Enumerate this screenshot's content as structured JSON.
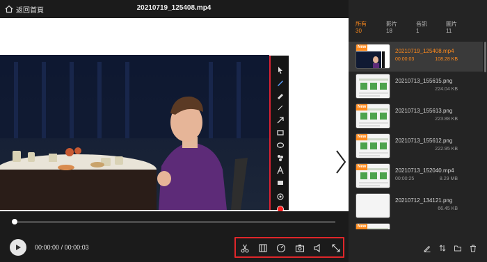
{
  "titlebar": {
    "back_label": "返回首頁",
    "title": "20210719_125408.mp4"
  },
  "player": {
    "current_time": "00:00:00",
    "separator": "/",
    "total_time": "00:00:03",
    "progress": 0.0
  },
  "toolbar_icons": [
    "scissors-icon",
    "trim-icon",
    "speed-icon",
    "snapshot-icon",
    "volume-icon",
    "crop-icon"
  ],
  "annotation_tools": [
    "pointer-icon",
    "pen-icon",
    "marker-icon",
    "line-icon",
    "arrow-icon",
    "rectangle-icon",
    "ellipse-icon",
    "mosaic-icon",
    "text-icon",
    "image-icon",
    "step-icon",
    "color-icon",
    "undo-icon"
  ],
  "tabs": [
    {
      "label": "所有",
      "count": "30"
    },
    {
      "label": "影片",
      "count": "18"
    },
    {
      "label": "音訊",
      "count": "1"
    },
    {
      "label": "圖片",
      "count": "11"
    }
  ],
  "files": [
    {
      "name": "20210719_125408.mp4",
      "duration": "00:00:03",
      "size": "108.28 KB",
      "new": true,
      "badge": "New",
      "kind": "video"
    },
    {
      "name": "20210713_155615.png",
      "duration": "",
      "size": "224.04 KB",
      "new": false,
      "badge": "",
      "kind": "image"
    },
    {
      "name": "20210713_155613.png",
      "duration": "",
      "size": "223.88 KB",
      "new": true,
      "badge": "New",
      "kind": "image"
    },
    {
      "name": "20210713_155612.png",
      "duration": "",
      "size": "222.95 KB",
      "new": true,
      "badge": "New",
      "kind": "image"
    },
    {
      "name": "20210713_152040.mp4",
      "duration": "00:00:25",
      "size": "8.29 MB",
      "new": true,
      "badge": "New",
      "kind": "image"
    },
    {
      "name": "20210712_134121.png",
      "duration": "",
      "size": "66.45 KB",
      "new": false,
      "badge": "",
      "kind": "blank"
    },
    {
      "name": "",
      "duration": "",
      "size": "",
      "new": true,
      "badge": "New",
      "kind": "image"
    }
  ],
  "colors": {
    "accent": "#ff8a1c",
    "highlight_box": "#e0262a",
    "panel_bg": "#242424",
    "app_bg": "#1b1b1b"
  }
}
